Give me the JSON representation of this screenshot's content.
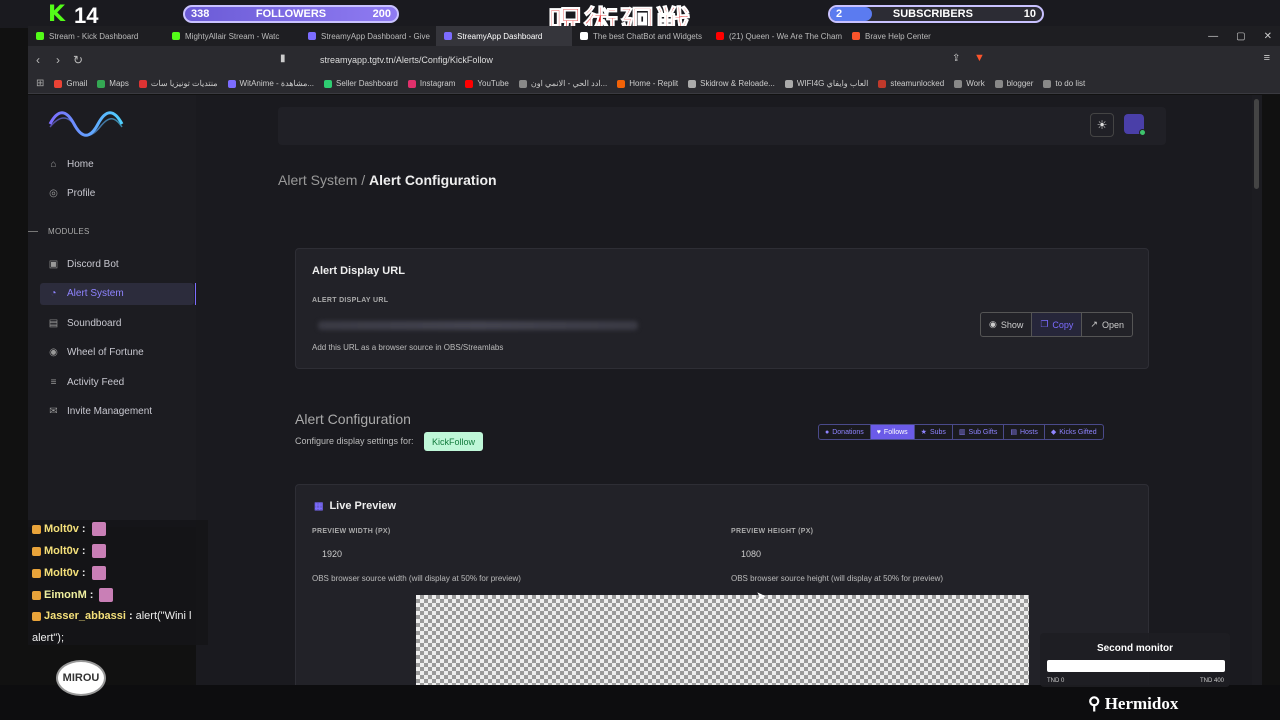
{
  "stream_overlay": {
    "kick_count": "14",
    "followers_label": "FOLLOWERS",
    "followers_current": "338",
    "followers_goal": "200",
    "subscribers_label": "SUBSCRIBERS",
    "subscribers_current": "2",
    "subscribers_goal": "10",
    "subscribers_progress": 0.2,
    "jp_title": "呪術廻戦"
  },
  "browser": {
    "tabs": [
      {
        "label": "Stream - Kick Dashboard",
        "color": "#53fc18",
        "active": false
      },
      {
        "label": "MightyAllair Stream - Watc",
        "color": "#53fc18",
        "active": false
      },
      {
        "label": "StreamyApp Dashboard - Give",
        "color": "#7c6cff",
        "active": false
      },
      {
        "label": "StreamyApp Dashboard",
        "color": "#7c6cff",
        "active": true
      },
      {
        "label": "The best ChatBot and Widgets",
        "color": "#ffffff",
        "active": false
      },
      {
        "label": "(21) Queen - We Are The Cham",
        "color": "#ff0000",
        "active": false
      },
      {
        "label": "Brave Help Center",
        "color": "#fb542b",
        "active": false
      }
    ],
    "url": "streamyapp.tgtv.tn/Alerts/Config/KickFollow",
    "bookmarks": [
      {
        "label": "Gmail",
        "color": "#ea4335"
      },
      {
        "label": "Maps",
        "color": "#34a853"
      },
      {
        "label": "منتديات تونيزيا سات",
        "color": "#d33"
      },
      {
        "label": "WitAnime - مشاهدة...",
        "color": "#7c6cff"
      },
      {
        "label": "Seller Dashboard",
        "color": "#2ecc71"
      },
      {
        "label": "Instagram",
        "color": "#e1306c"
      },
      {
        "label": "YouTube",
        "color": "#ff0000"
      },
      {
        "label": "ادد الحي - الانمي اون...",
        "color": "#888"
      },
      {
        "label": "Home - Replit",
        "color": "#f26207"
      },
      {
        "label": "Skidrow & Reloade...",
        "color": "#aaa"
      },
      {
        "label": "WIFI4G العاب وايفاي",
        "color": "#aaa"
      },
      {
        "label": "steamunlocked",
        "color": "#c0392b"
      },
      {
        "label": "Work",
        "color": "#888"
      },
      {
        "label": "blogger",
        "color": "#888"
      },
      {
        "label": "to do list",
        "color": "#888"
      }
    ]
  },
  "sidebar": {
    "items_top": [
      {
        "label": "Home",
        "icon": "home-icon",
        "glyph": "⌂"
      },
      {
        "label": "Profile",
        "icon": "profile-icon",
        "glyph": "◎"
      }
    ],
    "modules_label": "MODULES",
    "modules": [
      {
        "label": "Discord Bot",
        "icon": "discord-icon",
        "glyph": "▣",
        "active": false
      },
      {
        "label": "Alert System",
        "icon": "bell-icon",
        "glyph": "◔",
        "active": true
      },
      {
        "label": "Soundboard",
        "icon": "speaker-icon",
        "glyph": "▤",
        "active": false
      },
      {
        "label": "Wheel of Fortune",
        "icon": "wheel-icon",
        "glyph": "◉",
        "active": false
      },
      {
        "label": "Activity Feed",
        "icon": "list-icon",
        "glyph": "≡",
        "active": false
      },
      {
        "label": "Invite Management",
        "icon": "mail-icon",
        "glyph": "✉",
        "active": false
      }
    ]
  },
  "breadcrumb": {
    "parent": "Alert System /",
    "current": "Alert Configuration"
  },
  "display_url": {
    "title": "Alert Display URL",
    "field_label": "ALERT DISPLAY URL",
    "help": "Add this URL as a browser source in OBS/Streamlabs",
    "show_label": "Show",
    "copy_label": "Copy",
    "open_label": "Open"
  },
  "config": {
    "title": "Alert Configuration",
    "subtitle": "Configure display settings for:",
    "badge": "KickFollow",
    "types": [
      {
        "label": "Donations",
        "glyph": "●",
        "active": false
      },
      {
        "label": "Follows",
        "glyph": "♥",
        "active": true
      },
      {
        "label": "Subs",
        "glyph": "★",
        "active": false
      },
      {
        "label": "Sub Gifts",
        "glyph": "▥",
        "active": false
      },
      {
        "label": "Hosts",
        "glyph": "▤",
        "active": false
      },
      {
        "label": "Kicks Gifted",
        "glyph": "◆",
        "active": false
      }
    ]
  },
  "preview": {
    "title": "Live Preview",
    "width_label": "PREVIEW WIDTH (PX)",
    "width_value": "1920",
    "width_help": "OBS browser source width (will display at 50% for preview)",
    "height_label": "PREVIEW HEIGHT (PX)",
    "height_value": "1080",
    "height_help": "OBS browser source height (will display at 50% for preview)"
  },
  "chat": [
    {
      "user": "Molt0v",
      "msg": ""
    },
    {
      "user": "Molt0v",
      "msg": ""
    },
    {
      "user": "Molt0v",
      "msg": ""
    },
    {
      "user": "EimonM",
      "msg": ""
    },
    {
      "user": "Jasser_abbassi",
      "msg": "alert(\"Wini l"
    },
    {
      "user": "",
      "msg": "alert\");"
    }
  ],
  "mirou_label": "MIROU",
  "monitor": {
    "title": "Second monitor",
    "min": "TND 0",
    "max": "TND 400"
  },
  "hermidox": "Hermidox"
}
